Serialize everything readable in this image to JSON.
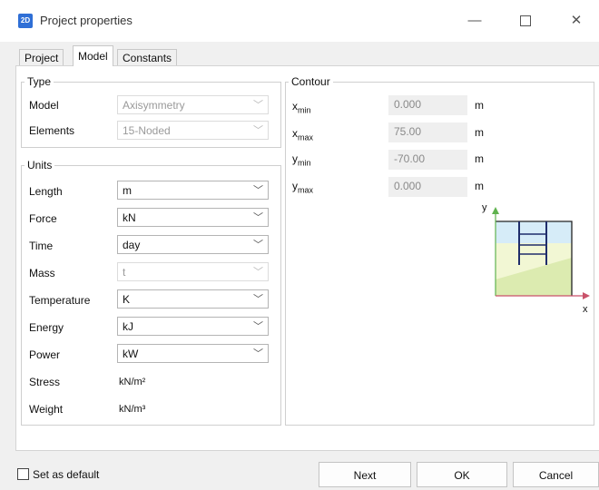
{
  "window": {
    "title": "Project properties",
    "icon_label": "2D",
    "minimize": "—",
    "close": "✕"
  },
  "tabs": [
    "Project",
    "Model",
    "Constants"
  ],
  "active_tab": "Model",
  "type_group": {
    "title": "Type",
    "rows": [
      {
        "label": "Model",
        "value": "Axisymmetry",
        "disabled": true
      },
      {
        "label": "Elements",
        "value": "15-Noded",
        "disabled": true
      }
    ]
  },
  "units_group": {
    "title": "Units",
    "rows": [
      {
        "label": "Length",
        "value": "m",
        "disabled": false
      },
      {
        "label": "Force",
        "value": "kN",
        "disabled": false
      },
      {
        "label": "Time",
        "value": "day",
        "disabled": false
      },
      {
        "label": "Mass",
        "value": "t",
        "disabled": true
      },
      {
        "label": "Temperature",
        "value": "K",
        "disabled": false
      },
      {
        "label": "Energy",
        "value": "kJ",
        "disabled": false
      },
      {
        "label": "Power",
        "value": "kW",
        "disabled": false
      }
    ],
    "derived": [
      {
        "label": "Stress",
        "value": "kN/m²"
      },
      {
        "label": "Weight",
        "value": "kN/m³"
      }
    ]
  },
  "contour_group": {
    "title": "Contour",
    "rows": [
      {
        "var": "x",
        "sub": "min",
        "value": "0.000",
        "unit": "m"
      },
      {
        "var": "x",
        "sub": "max",
        "value": "75.00",
        "unit": "m"
      },
      {
        "var": "y",
        "sub": "min",
        "value": "-70.00",
        "unit": "m"
      },
      {
        "var": "y",
        "sub": "max",
        "value": "0.000",
        "unit": "m"
      }
    ],
    "axis_x": "x",
    "axis_y": "y"
  },
  "footer": {
    "set_default": "Set as default",
    "next": "Next",
    "ok": "OK",
    "cancel": "Cancel"
  },
  "colors": {
    "soil_light": "#f2f7d4",
    "soil_dark": "#dcebb0",
    "water": "#d6ecf8",
    "structure": "#1f2d6b",
    "axis_x": "#c9526a",
    "axis_y": "#5fb24e",
    "icon_blue": "#2f6fd6"
  }
}
